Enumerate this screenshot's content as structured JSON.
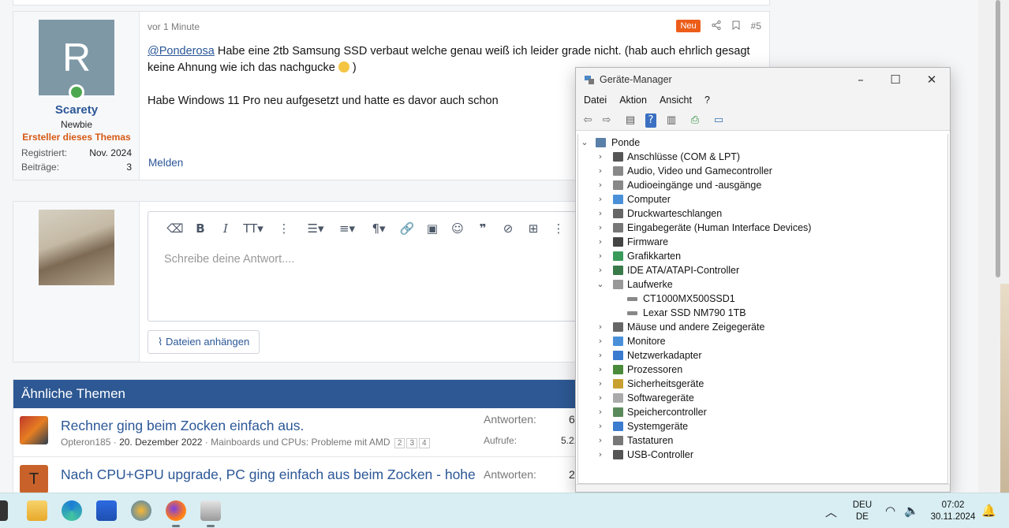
{
  "post": {
    "time": "vor 1 Minute",
    "badge": "Neu",
    "number": "#5",
    "user": {
      "initial": "R",
      "name": "Scarety",
      "title": "Newbie",
      "starter": "Ersteller dieses Themas",
      "registered_label": "Registriert:",
      "registered_value": "Nov. 2024",
      "posts_label": "Beiträge:",
      "posts_value": "3"
    },
    "mention": "@Ponderosa",
    "line1": " Habe eine 2tb Samsung SSD verbaut welche genau weiß ich leider grade nicht. (hab auch ehrlich gesagt keine Ahnung wie ich das nachgucke ",
    "line1_end": ")",
    "line2": "Habe Windows 11 Pro neu aufgesetzt und hatte es davor auch schon",
    "report": "Melden"
  },
  "reply": {
    "placeholder": "Schreibe deine Antwort....",
    "attach": "Dateien anhängen"
  },
  "similar": {
    "heading": "Ähnliche Themen",
    "threads": [
      {
        "title": "Rechner ging beim Zocken einfach aus.",
        "author": "Opteron185",
        "date": "20. Dezember 2022",
        "forum": "Mainboards und CPUs: Probleme mit AMD",
        "pages": [
          "2",
          "3",
          "4"
        ],
        "replies_label": "Antworten:",
        "replies": "6",
        "views_label": "Aufrufe:",
        "views": "5.21"
      },
      {
        "title": "Nach CPU+GPU upgrade, PC ging einfach aus beim Zocken - hohe",
        "initial": "T",
        "replies_label": "Antworten:",
        "replies": "2"
      }
    ]
  },
  "devmgr": {
    "title": "Geräte-Manager",
    "menu": [
      "Datei",
      "Aktion",
      "Ansicht",
      "?"
    ],
    "root": "Ponde",
    "nodes": [
      {
        "label": "Anschlüsse (COM & LPT)",
        "icon": "port-icon"
      },
      {
        "label": "Audio, Video und Gamecontroller",
        "icon": "speaker-icon"
      },
      {
        "label": "Audioeingänge und -ausgänge",
        "icon": "speaker-icon"
      },
      {
        "label": "Computer",
        "icon": "monitor-icon"
      },
      {
        "label": "Druckwarteschlangen",
        "icon": "printer-icon"
      },
      {
        "label": "Eingabegeräte (Human Interface Devices)",
        "icon": "keyboard-icon"
      },
      {
        "label": "Firmware",
        "icon": "chip-icon"
      },
      {
        "label": "Grafikkarten",
        "icon": "display-adapter-icon"
      },
      {
        "label": "IDE ATA/ATAPI-Controller",
        "icon": "controller-icon"
      },
      {
        "label": "Laufwerke",
        "icon": "disk-icon",
        "expanded": true,
        "children": [
          "CT1000MX500SSD1",
          "Lexar SSD NM790 1TB"
        ]
      },
      {
        "label": "Mäuse und andere Zeigegeräte",
        "icon": "mouse-icon"
      },
      {
        "label": "Monitore",
        "icon": "monitor-icon"
      },
      {
        "label": "Netzwerkadapter",
        "icon": "network-icon"
      },
      {
        "label": "Prozessoren",
        "icon": "cpu-icon"
      },
      {
        "label": "Sicherheitsgeräte",
        "icon": "security-icon"
      },
      {
        "label": "Softwaregeräte",
        "icon": "software-device-icon"
      },
      {
        "label": "Speichercontroller",
        "icon": "storage-controller-icon"
      },
      {
        "label": "Systemgeräte",
        "icon": "system-device-icon"
      },
      {
        "label": "Tastaturen",
        "icon": "keyboard-icon"
      },
      {
        "label": "USB-Controller",
        "icon": "usb-icon"
      }
    ]
  },
  "taskbar": {
    "lang1": "DEU",
    "lang2": "DE",
    "time": "07:02",
    "date": "30.11.2024"
  },
  "colors": {
    "link": "#2b5797",
    "accent_orange": "#ec5d19",
    "header_blue": "#2d5893",
    "taskbar": "#d8eef3"
  }
}
